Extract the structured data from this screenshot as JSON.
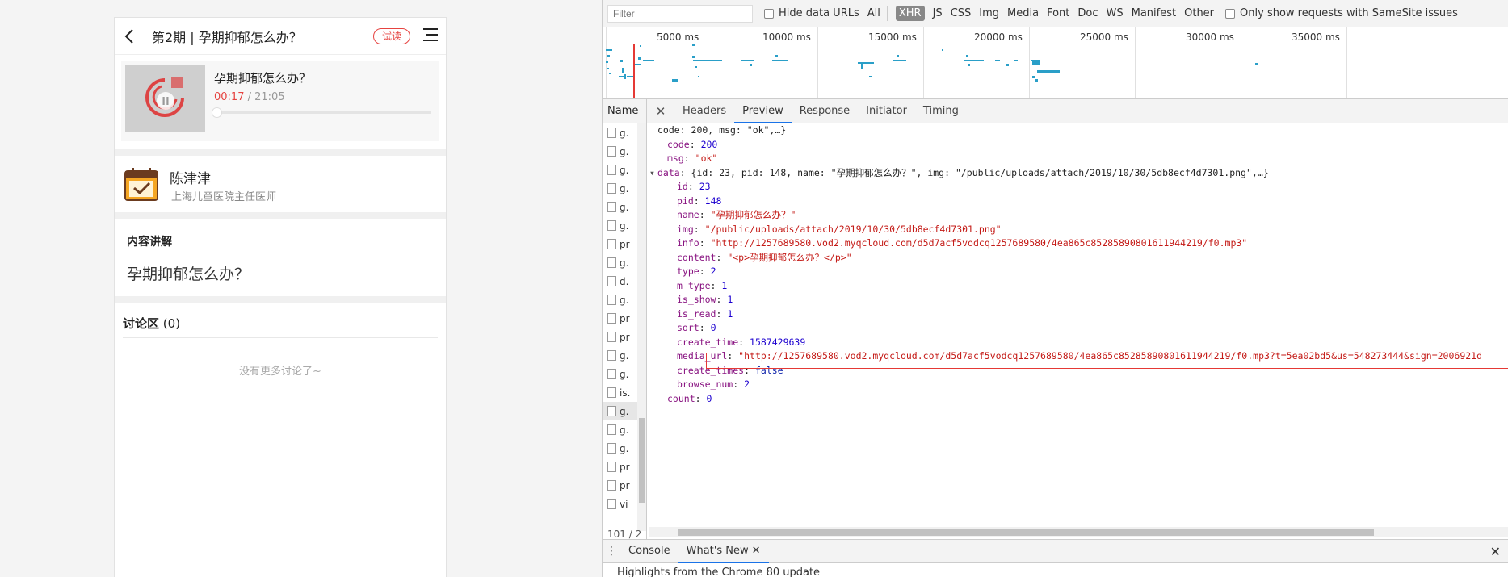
{
  "mobile": {
    "header": {
      "title": "第2期 | 孕期抑郁怎么办？",
      "badge": "试读"
    },
    "player": {
      "title": "孕期抑郁怎么办？",
      "current": "00:17",
      "separator": " / ",
      "duration": "21:05",
      "progress": 0.013
    },
    "teacher": {
      "name": "陈津津",
      "desc": "上海儿童医院主任医师"
    },
    "content": {
      "heading": "内容讲解",
      "body": "孕期抑郁怎么办？"
    },
    "discuss": {
      "heading": "讨论区",
      "count": "(0)",
      "empty": "没有更多讨论了~"
    }
  },
  "devtools": {
    "filter": {
      "placeholder": "Filter",
      "hide_data_urls": "Hide data URLs",
      "types": [
        "All",
        "XHR",
        "JS",
        "CSS",
        "Img",
        "Media",
        "Font",
        "Doc",
        "WS",
        "Manifest",
        "Other"
      ],
      "active_type": "XHR",
      "samesite": "Only show requests with SameSite issues"
    },
    "overview": {
      "ticks": [
        "5000 ms",
        "10000 ms",
        "15000 ms",
        "20000 ms",
        "25000 ms",
        "30000 ms",
        "35000 ms"
      ]
    },
    "tabs": {
      "name_col": "Name",
      "items": [
        "Headers",
        "Preview",
        "Response",
        "Initiator",
        "Timing"
      ],
      "active": "Preview"
    },
    "requests": [
      "g.",
      "g.",
      "g.",
      "g.",
      "g.",
      "g.",
      "pr",
      "g.",
      "d.",
      "g.",
      "pr",
      "pr",
      "g.",
      "g.",
      "is.",
      "g.",
      "g.",
      "g.",
      "pr",
      "pr",
      "vi"
    ],
    "request_count": "101 / 2",
    "preview": [
      {
        "indent": 0,
        "arrow": "",
        "parts": [
          [
            "plain",
            "code: 200, msg: \"ok\",…}"
          ]
        ]
      },
      {
        "indent": 1,
        "arrow": "",
        "parts": [
          [
            "k",
            "code"
          ],
          [
            "plain",
            ": "
          ],
          [
            "n",
            "200"
          ]
        ]
      },
      {
        "indent": 1,
        "arrow": "",
        "parts": [
          [
            "k",
            "msg"
          ],
          [
            "plain",
            ": "
          ],
          [
            "s",
            "\"ok\""
          ]
        ]
      },
      {
        "indent": 0,
        "arrow": "▾",
        "parts": [
          [
            "k",
            "data"
          ],
          [
            "plain",
            ": {id: 23, pid: 148, name: \"孕期抑郁怎么办？\", img: \"/public/uploads/attach/2019/10/30/5db8ecf4d7301.png\",…}"
          ]
        ]
      },
      {
        "indent": 2,
        "arrow": "",
        "parts": [
          [
            "k",
            "id"
          ],
          [
            "plain",
            ": "
          ],
          [
            "n",
            "23"
          ]
        ]
      },
      {
        "indent": 2,
        "arrow": "",
        "parts": [
          [
            "k",
            "pid"
          ],
          [
            "plain",
            ": "
          ],
          [
            "n",
            "148"
          ]
        ]
      },
      {
        "indent": 2,
        "arrow": "",
        "parts": [
          [
            "k",
            "name"
          ],
          [
            "plain",
            ": "
          ],
          [
            "s",
            "\"孕期抑郁怎么办？\""
          ]
        ]
      },
      {
        "indent": 2,
        "arrow": "",
        "parts": [
          [
            "k",
            "img"
          ],
          [
            "plain",
            ": "
          ],
          [
            "s",
            "\"/public/uploads/attach/2019/10/30/5db8ecf4d7301.png\""
          ]
        ]
      },
      {
        "indent": 2,
        "arrow": "",
        "parts": [
          [
            "k",
            "info"
          ],
          [
            "plain",
            ": "
          ],
          [
            "s",
            "\"http://1257689580.vod2.myqcloud.com/d5d7acf5vodcq1257689580/4ea865c85285890801611944219/f0.mp3\""
          ]
        ]
      },
      {
        "indent": 2,
        "arrow": "",
        "parts": [
          [
            "k",
            "content"
          ],
          [
            "plain",
            ": "
          ],
          [
            "s",
            "\"<p>孕期抑郁怎么办？</p>\""
          ]
        ]
      },
      {
        "indent": 2,
        "arrow": "",
        "parts": [
          [
            "k",
            "type"
          ],
          [
            "plain",
            ": "
          ],
          [
            "n",
            "2"
          ]
        ]
      },
      {
        "indent": 2,
        "arrow": "",
        "parts": [
          [
            "k",
            "m_type"
          ],
          [
            "plain",
            ": "
          ],
          [
            "n",
            "1"
          ]
        ]
      },
      {
        "indent": 2,
        "arrow": "",
        "parts": [
          [
            "k",
            "is_show"
          ],
          [
            "plain",
            ": "
          ],
          [
            "n",
            "1"
          ]
        ]
      },
      {
        "indent": 2,
        "arrow": "",
        "parts": [
          [
            "k",
            "is_read"
          ],
          [
            "plain",
            ": "
          ],
          [
            "n",
            "1"
          ]
        ]
      },
      {
        "indent": 2,
        "arrow": "",
        "parts": [
          [
            "k",
            "sort"
          ],
          [
            "plain",
            ": "
          ],
          [
            "n",
            "0"
          ]
        ]
      },
      {
        "indent": 2,
        "arrow": "",
        "parts": [
          [
            "k",
            "create_time"
          ],
          [
            "plain",
            ": "
          ],
          [
            "n",
            "1587429639"
          ]
        ]
      },
      {
        "indent": 2,
        "arrow": "",
        "parts": [
          [
            "k",
            "media_url"
          ],
          [
            "plain",
            ": "
          ],
          [
            "s",
            "\"http://1257689580.vod2.myqcloud.com/d5d7acf5vodcq1257689580/4ea865c85285890801611944219/f0.mp3?t=5ea02bd5&us=548273444&sign=2006921d"
          ]
        ]
      },
      {
        "indent": 2,
        "arrow": "",
        "parts": [
          [
            "k",
            "create_times"
          ],
          [
            "plain",
            ": "
          ],
          [
            "b",
            "false"
          ]
        ]
      },
      {
        "indent": 2,
        "arrow": "",
        "parts": [
          [
            "k",
            "browse_num"
          ],
          [
            "plain",
            ": "
          ],
          [
            "n",
            "2"
          ]
        ]
      },
      {
        "indent": 1,
        "arrow": "",
        "parts": [
          [
            "k",
            "count"
          ],
          [
            "plain",
            ": "
          ],
          [
            "n",
            "0"
          ]
        ]
      }
    ],
    "drawer": {
      "tabs": [
        "Console",
        "What's New"
      ],
      "active": "What's New",
      "body": "Highlights from the Chrome 80 update"
    }
  },
  "colors": {
    "accent_red": "#e64340",
    "devtools_blue": "#1a73e8",
    "timeline_teal": "#2a9fc8"
  }
}
